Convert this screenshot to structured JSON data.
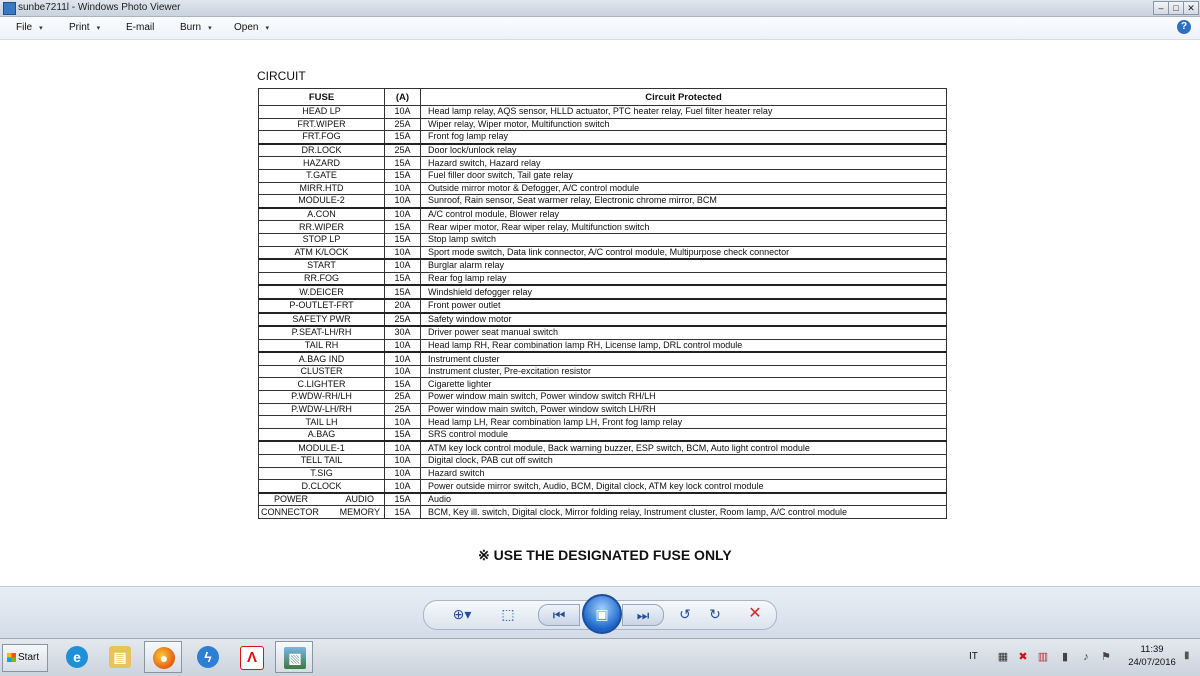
{
  "window": {
    "title": "sunbe7211l - Windows Photo Viewer",
    "controls": {
      "minimize": "–",
      "maximize": "□",
      "close": "✕"
    }
  },
  "menu": {
    "items": [
      {
        "label": "File",
        "arrow": "▾"
      },
      {
        "label": "Print",
        "arrow": "▾"
      },
      {
        "label": "E-mail"
      },
      {
        "label": "Burn",
        "arrow": "▾"
      },
      {
        "label": "Open",
        "arrow": "▾"
      }
    ],
    "help": "?"
  },
  "document": {
    "heading": "CIRCUIT",
    "columns": [
      "FUSE",
      "(A)",
      "Circuit Protected"
    ],
    "rows": [
      {
        "fuse": "HEAD LP",
        "amp": "10A",
        "desc": "Head lamp relay, AQS sensor, HLLD actuator, PTC heater relay, Fuel filter heater relay"
      },
      {
        "fuse": "FRT.WIPER",
        "amp": "25A",
        "desc": "Wiper relay, Wiper motor, Multifunction switch"
      },
      {
        "fuse": "FRT.FOG",
        "amp": "15A",
        "desc": "Front fog lamp relay"
      },
      {
        "fuse": "DR.LOCK",
        "amp": "25A",
        "desc": "Door lock/unlock relay"
      },
      {
        "fuse": "HAZARD",
        "amp": "15A",
        "desc": "Hazard switch, Hazard relay"
      },
      {
        "fuse": "T.GATE",
        "amp": "15A",
        "desc": "Fuel filler door switch, Tail gate relay"
      },
      {
        "fuse": "MIRR.HTD",
        "amp": "10A",
        "desc": "Outside mirror motor & Defogger, A/C control module"
      },
      {
        "fuse": "MODULE-2",
        "amp": "10A",
        "desc": "Sunroof, Rain sensor, Seat warmer relay, Electronic chrome mirror, BCM"
      },
      {
        "fuse": "A.CON",
        "amp": "10A",
        "desc": "A/C control module, Blower relay"
      },
      {
        "fuse": "RR.WIPER",
        "amp": "15A",
        "desc": "Rear wiper motor, Rear wiper relay, Multifunction switch"
      },
      {
        "fuse": "STOP LP",
        "amp": "15A",
        "desc": "Stop lamp switch"
      },
      {
        "fuse": "ATM K/LOCK",
        "amp": "10A",
        "desc": "Sport mode switch, Data link connector, A/C control module, Multipurpose check connector"
      },
      {
        "fuse": "START",
        "amp": "10A",
        "desc": "Burglar alarm relay"
      },
      {
        "fuse": "RR.FOG",
        "amp": "15A",
        "desc": "Rear fog lamp relay"
      },
      {
        "fuse": "W.DEICER",
        "amp": "15A",
        "desc": "Windshield defogger relay"
      },
      {
        "fuse": "P-OUTLET-FRT",
        "amp": "20A",
        "desc": "Front power outlet"
      },
      {
        "fuse": "SAFETY PWR",
        "amp": "25A",
        "desc": "Safety window motor"
      },
      {
        "fuse": "P.SEAT-LH/RH",
        "amp": "30A",
        "desc": "Driver power seat manual switch"
      },
      {
        "fuse": "TAIL RH",
        "amp": "10A",
        "desc": "Head lamp RH, Rear combination lamp RH, License lamp, DRL control module"
      },
      {
        "fuse": "A.BAG IND",
        "amp": "10A",
        "desc": "Instrument cluster"
      },
      {
        "fuse": "CLUSTER",
        "amp": "10A",
        "desc": "Instrument cluster, Pre-excitation resistor"
      },
      {
        "fuse": "C.LIGHTER",
        "amp": "15A",
        "desc": "Cigarette lighter"
      },
      {
        "fuse": "P.WDW-RH/LH",
        "amp": "25A",
        "desc": "Power window main switch, Power window switch RH/LH"
      },
      {
        "fuse": "P.WDW-LH/RH",
        "amp": "25A",
        "desc": "Power window main switch, Power window switch LH/RH"
      },
      {
        "fuse": "TAIL LH",
        "amp": "10A",
        "desc": "Head lamp LH, Rear combination lamp LH, Front fog lamp relay"
      },
      {
        "fuse": "A.BAG",
        "amp": "15A",
        "desc": "SRS control module"
      },
      {
        "fuse": "MODULE-1",
        "amp": "10A",
        "desc": "ATM key lock control module, Back warning buzzer, ESP switch, BCM, Auto light control module"
      },
      {
        "fuse": "TELL TAIL",
        "amp": "10A",
        "desc": "Digital clock, PAB cut off switch"
      },
      {
        "fuse": "T.SIG",
        "amp": "10A",
        "desc": "Hazard switch"
      },
      {
        "fuse": "D.CLOCK",
        "amp": "10A",
        "desc": "Power outside mirror switch, Audio, BCM, Digital clock, ATM key lock control module"
      }
    ],
    "power_connector": {
      "label_top": "POWER",
      "label_bottom": "CONNECTOR",
      "rows": [
        {
          "sub": "AUDIO",
          "amp": "15A",
          "desc": "Audio"
        },
        {
          "sub": "MEMORY",
          "amp": "15A",
          "desc": "BCM, Key ill. switch, Digital clock, Mirror folding relay, Instrument cluster, Room lamp, A/C control module"
        }
      ]
    },
    "footnote": "※ USE THE DESIGNATED FUSE ONLY"
  },
  "controls": {
    "zoom": "⊕▾",
    "actual_size": "⬚",
    "previous": "⏮",
    "slideshow": "▣",
    "next": "⏭",
    "rotate_ccw": "↺",
    "rotate_cw": "↻",
    "delete": "✕"
  },
  "taskbar": {
    "start": "Start",
    "apps": [
      "e",
      "▤",
      "●",
      "ϟ",
      "Λ",
      "▧"
    ],
    "language": "IT",
    "tray": [
      "▦",
      "✖",
      "▥",
      "▮",
      "♪",
      "⚑"
    ],
    "time": "11:39",
    "date": "24/07/2016",
    "show_desktop": "▮"
  }
}
